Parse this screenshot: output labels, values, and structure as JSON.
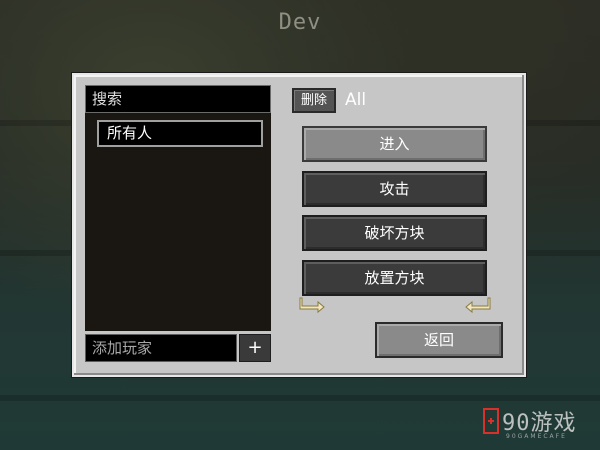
{
  "screen_title": "Dev",
  "search": {
    "placeholder": "搜索"
  },
  "players": [
    {
      "label": "所有人"
    }
  ],
  "add_player": {
    "placeholder": "添加玩家",
    "add_label": "+"
  },
  "delete_label": "删除",
  "group_name": "All",
  "permissions": [
    {
      "label": "进入"
    },
    {
      "label": "攻击"
    },
    {
      "label": "破坏方块"
    },
    {
      "label": "放置方块"
    }
  ],
  "back_label": "返回",
  "watermark": {
    "text": "90游戏",
    "sub": "90GAMECAFE"
  },
  "colors": {
    "panel": "#c6c6c6",
    "button_dark": "#3b3b3b",
    "button_light": "#8a8a8a",
    "arrow": "#f0e6c0",
    "watermark_accent": "#d9302c"
  }
}
